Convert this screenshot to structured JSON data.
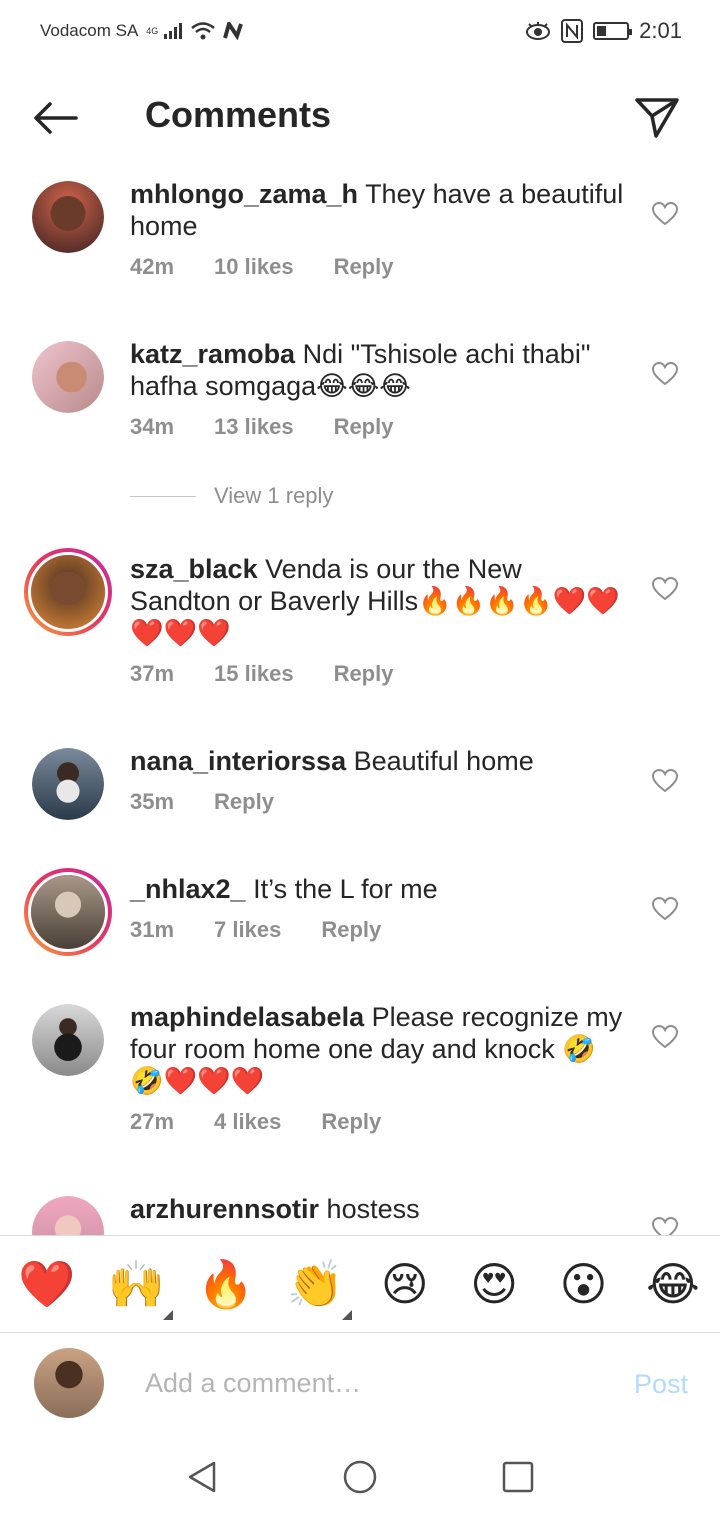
{
  "status_bar": {
    "carrier": "Vodacom SA",
    "network": "4G",
    "time": "2:01",
    "icons": [
      "signal-icon",
      "wifi-icon",
      "n-icon",
      "eye-icon",
      "nfc-icon",
      "battery-icon"
    ]
  },
  "header": {
    "title": "Comments",
    "back_icon": "arrow-left-icon",
    "share_icon": "paper-plane-icon"
  },
  "comments": [
    {
      "username": "mhlongo_zama_h",
      "text": "They have a beautiful home",
      "time": "42m",
      "likes": "10 likes",
      "reply": "Reply",
      "story_ring": false,
      "avatar_color": "#4a2e2e"
    },
    {
      "username": "katz_ramoba",
      "text": "Ndi \"Tshisole achi thabi\" hafha somgaga😂😂😂",
      "time": "34m",
      "likes": "13 likes",
      "reply": "Reply",
      "story_ring": false,
      "avatar_color": "#d9a3a3"
    },
    {
      "username": "sza_black",
      "text": "Venda is our the New Sandton or Baverly Hills🔥🔥🔥🔥❤️❤️❤️❤️❤️",
      "time": "37m",
      "likes": "15 likes",
      "reply": "Reply",
      "story_ring": true,
      "avatar_color": "#5a3a2a"
    },
    {
      "username": "nana_interiorssa",
      "text": "Beautiful home",
      "time": "35m",
      "likes": "",
      "reply": "Reply",
      "story_ring": false,
      "avatar_color": "#3e4a5a"
    },
    {
      "username": "_nhlax2_",
      "text": "It’s the L for me",
      "time": "31m",
      "likes": "7 likes",
      "reply": "Reply",
      "story_ring": true,
      "avatar_color": "#7a6a5a"
    },
    {
      "username": "maphindelasabela",
      "text": "Please recognize my four room home one day and knock 🤣🤣❤️❤️❤️",
      "time": "27m",
      "likes": "4 likes",
      "reply": "Reply",
      "story_ring": false,
      "avatar_color": "#8a8a8a"
    },
    {
      "username": "arzhurennsotir",
      "text": "hostess",
      "time": "",
      "likes": "",
      "reply": "",
      "story_ring": false,
      "avatar_color": "#e3b7c4"
    }
  ],
  "view_replies": "View 1 reply",
  "emoji_bar": [
    "❤️",
    "🙌",
    "🔥",
    "👏",
    "😢",
    "😍",
    "😮",
    "😂"
  ],
  "compose": {
    "placeholder": "Add a comment…",
    "post_label": "Post"
  },
  "nav": [
    "back-triangle-icon",
    "home-circle-icon",
    "recents-square-icon"
  ]
}
